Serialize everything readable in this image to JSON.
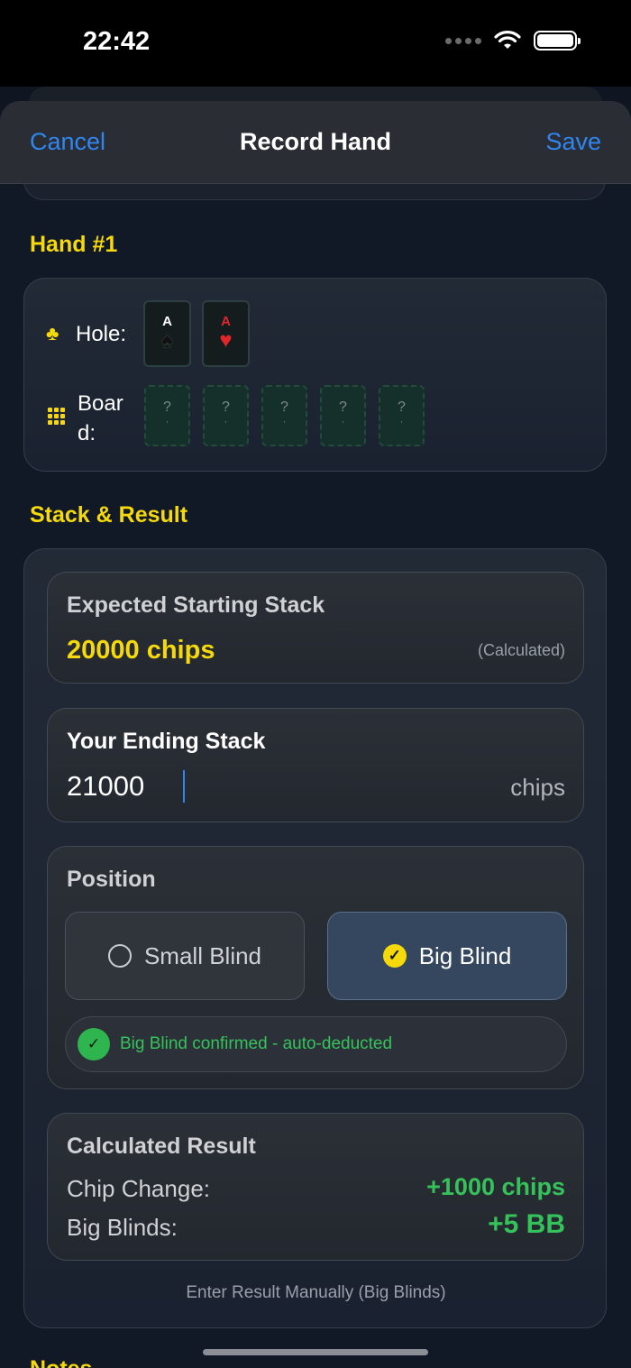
{
  "status_bar": {
    "time": "22:42"
  },
  "nav": {
    "cancel": "Cancel",
    "title": "Record Hand",
    "save": "Save"
  },
  "hand": {
    "header": "Hand #1",
    "hole_label": "Hole:",
    "board_label_line1": "Boar",
    "board_label_line2": "d:",
    "hole_cards": [
      {
        "rank": "A",
        "suit": "♠",
        "color": "#111111"
      },
      {
        "rank": "A",
        "suit": "♥",
        "color": "#e0262b"
      }
    ],
    "board_placeholder": "?",
    "board_dot": "·"
  },
  "stack": {
    "header": "Stack & Result",
    "expected_label": "Expected Starting Stack",
    "expected_value": "20000 chips",
    "expected_note": "(Calculated)",
    "ending_label": "Your Ending Stack",
    "ending_value": "21000",
    "ending_unit": "chips",
    "position_label": "Position",
    "small_blind": "Small Blind",
    "big_blind": "Big Blind",
    "selected_position": "Big Blind",
    "confirm_text": "Big Blind confirmed - auto-deducted",
    "result_label": "Calculated Result",
    "chip_change_label": "Chip Change:",
    "chip_change_value": "+1000 chips",
    "bb_label": "Big Blinds:",
    "bb_value": "+5 BB",
    "manual_link": "Enter Result Manually (Big Blinds)"
  },
  "notes": {
    "header": "Notes"
  },
  "colors": {
    "accent_yellow": "#f5d90a",
    "link_blue": "#2f86f0",
    "positive_green": "#35c25a"
  }
}
